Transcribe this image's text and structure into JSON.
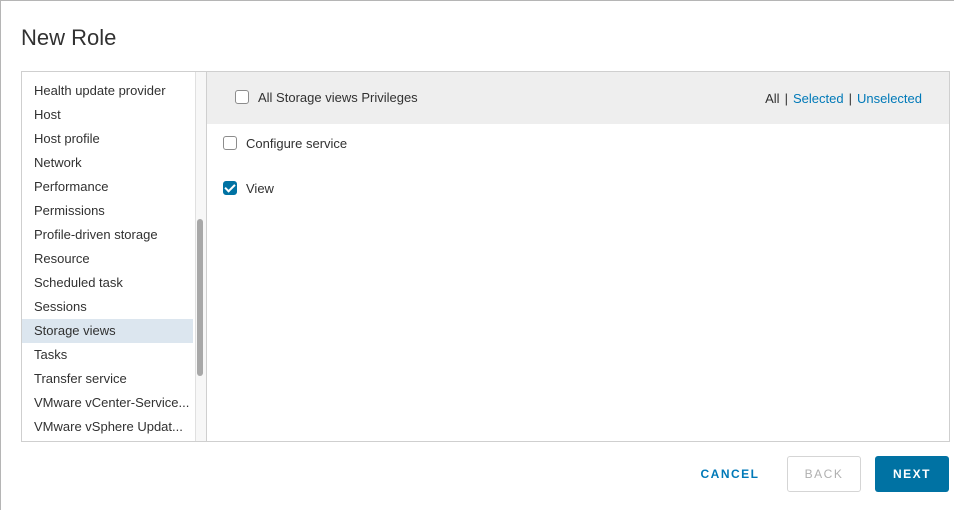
{
  "dialog": {
    "title": "New Role"
  },
  "categories": [
    "Health update provider",
    "Host",
    "Host profile",
    "Network",
    "Performance",
    "Permissions",
    "Profile-driven storage",
    "Resource",
    "Scheduled task",
    "Sessions",
    "Storage views",
    "Tasks",
    "Transfer service",
    "VMware vCenter-Service...",
    "VMware vSphere Updat..."
  ],
  "selected_category": "Storage views",
  "privileges": {
    "all_label": "All Storage views Privileges",
    "all_checked": false,
    "filter": {
      "all": "All",
      "selected": "Selected",
      "unselected": "Unselected"
    },
    "items": [
      {
        "label": "Configure service",
        "checked": false
      },
      {
        "label": "View",
        "checked": true
      }
    ]
  },
  "footer": {
    "cancel": "CANCEL",
    "back": "BACK",
    "next": "NEXT"
  },
  "colors": {
    "accent": "#0072a3",
    "link": "#0079b8",
    "selected_row": "#dce6ef"
  }
}
